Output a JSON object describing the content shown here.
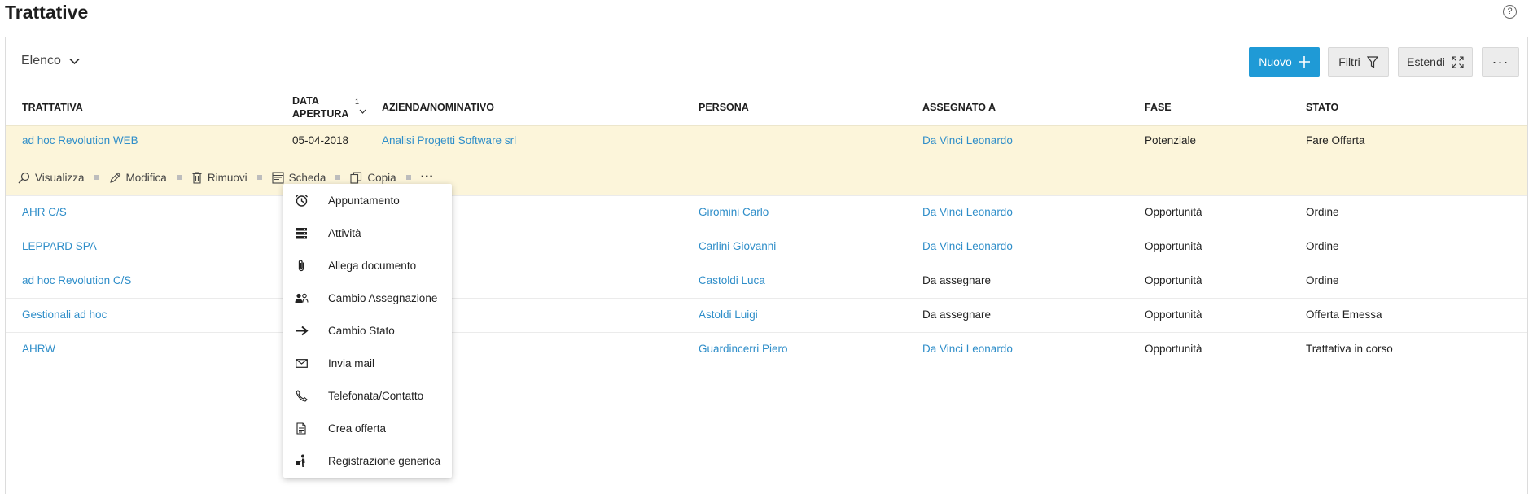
{
  "page": {
    "title": "Trattative",
    "help": "?"
  },
  "toolbar": {
    "view_label": "Elenco",
    "new_label": "Nuovo",
    "filter_label": "Filtri",
    "expand_label": "Estendi",
    "more_label": "···"
  },
  "columns": {
    "trattativa": "TRATTATIVA",
    "data_line1": "DATA",
    "data_line2": "APERTURA",
    "sort_index": "1",
    "azienda": "AZIENDA/NOMINATIVO",
    "persona": "PERSONA",
    "assegnato": "ASSEGNATO A",
    "fase": "FASE",
    "stato": "STATO"
  },
  "selected_row": {
    "trattativa": "ad hoc Revolution WEB",
    "data": "05-04-2018",
    "azienda": "Analisi Progetti Software srl",
    "persona": "",
    "assegnato": "Da Vinci Leonardo",
    "fase": "Potenziale",
    "stato": "Fare Offerta"
  },
  "row_actions": {
    "view": "Visualizza",
    "edit": "Modifica",
    "remove": "Rimuovi",
    "card": "Scheda",
    "copy": "Copia",
    "more": "···"
  },
  "rows": [
    {
      "trattativa": "AHR C/S",
      "persona": "Giromini Carlo",
      "assegnato": "Da Vinci Leonardo",
      "assegnato_link": true,
      "fase": "Opportunità",
      "stato": "Ordine"
    },
    {
      "trattativa": "LEPPARD SPA",
      "persona": "Carlini Giovanni",
      "assegnato": "Da Vinci Leonardo",
      "assegnato_link": true,
      "fase": "Opportunità",
      "stato": "Ordine"
    },
    {
      "trattativa": "ad hoc Revolution C/S",
      "persona": "Castoldi Luca",
      "assegnato": "Da assegnare",
      "assegnato_link": false,
      "fase": "Opportunità",
      "stato": "Ordine"
    },
    {
      "trattativa": "Gestionali ad hoc",
      "persona": "Astoldi Luigi",
      "assegnato": "Da assegnare",
      "assegnato_link": false,
      "fase": "Opportunità",
      "stato": "Offerta Emessa"
    },
    {
      "trattativa": "AHRW",
      "persona": "Guardincerri Piero",
      "assegnato": "Da Vinci Leonardo",
      "assegnato_link": true,
      "fase": "Opportunità",
      "stato": "Trattativa in corso"
    }
  ],
  "context_menu": [
    {
      "label": "Appuntamento",
      "icon": "alarm-clock-icon"
    },
    {
      "label": "Attività",
      "icon": "stack-icon"
    },
    {
      "label": "Allega documento",
      "icon": "paperclip-icon"
    },
    {
      "label": "Cambio Assegnazione",
      "icon": "users-icon"
    },
    {
      "label": "Cambio Stato",
      "icon": "arrow-right-icon"
    },
    {
      "label": "Invia mail",
      "icon": "envelope-icon"
    },
    {
      "label": "Telefonata/Contatto",
      "icon": "phone-icon"
    },
    {
      "label": "Crea offerta",
      "icon": "document-icon"
    },
    {
      "label": "Registrazione generica",
      "icon": "person-walking-icon"
    }
  ],
  "colors": {
    "accent": "#1f9ad6",
    "link": "#2f8ec9",
    "highlight_row": "#fcf5da"
  }
}
